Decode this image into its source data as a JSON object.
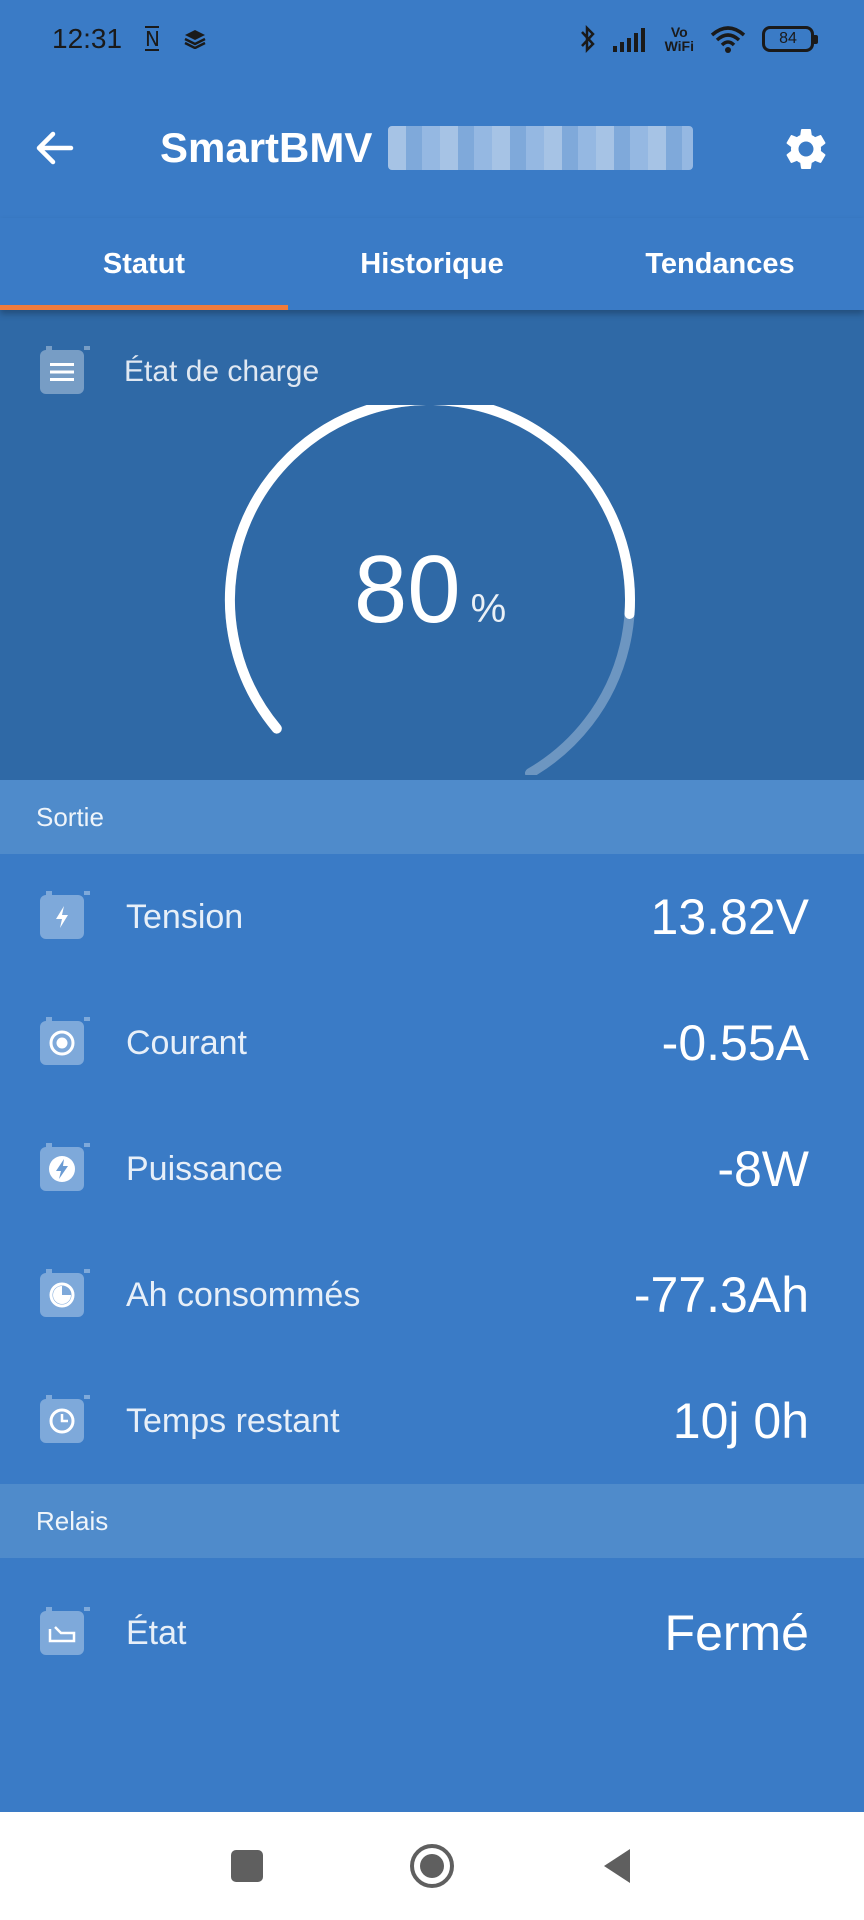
{
  "status_bar": {
    "time": "12:31",
    "battery": "84",
    "network_label": "Vo\nWiFi"
  },
  "app_bar": {
    "title": "SmartBMV",
    "back_icon": "arrow-left-icon",
    "settings_icon": "gear-icon"
  },
  "tabs": [
    {
      "label": "Statut",
      "active": true
    },
    {
      "label": "Historique",
      "active": false
    },
    {
      "label": "Tendances",
      "active": false
    }
  ],
  "state_of_charge": {
    "label": "État de charge",
    "value": "80",
    "unit": "%",
    "fraction": 0.8
  },
  "output": {
    "header": "Sortie",
    "rows": [
      {
        "icon": "voltage-icon",
        "label": "Tension",
        "value": "13.82V"
      },
      {
        "icon": "current-icon",
        "label": "Courant",
        "value": "-0.55A"
      },
      {
        "icon": "power-icon",
        "label": "Puissance",
        "value": "-8W"
      },
      {
        "icon": "consumed-icon",
        "label": "Ah consommés",
        "value": "-77.3Ah"
      },
      {
        "icon": "clock-icon",
        "label": "Temps restant",
        "value": "10j 0h"
      }
    ]
  },
  "relay": {
    "header": "Relais",
    "rows": [
      {
        "icon": "relay-icon",
        "label": "État",
        "value": "Fermé"
      }
    ]
  },
  "colors": {
    "primary": "#3a7bc6",
    "soc_background": "#2f69a6",
    "section_header": "#4f8bcb",
    "tab_indicator": "#f07b3a"
  }
}
